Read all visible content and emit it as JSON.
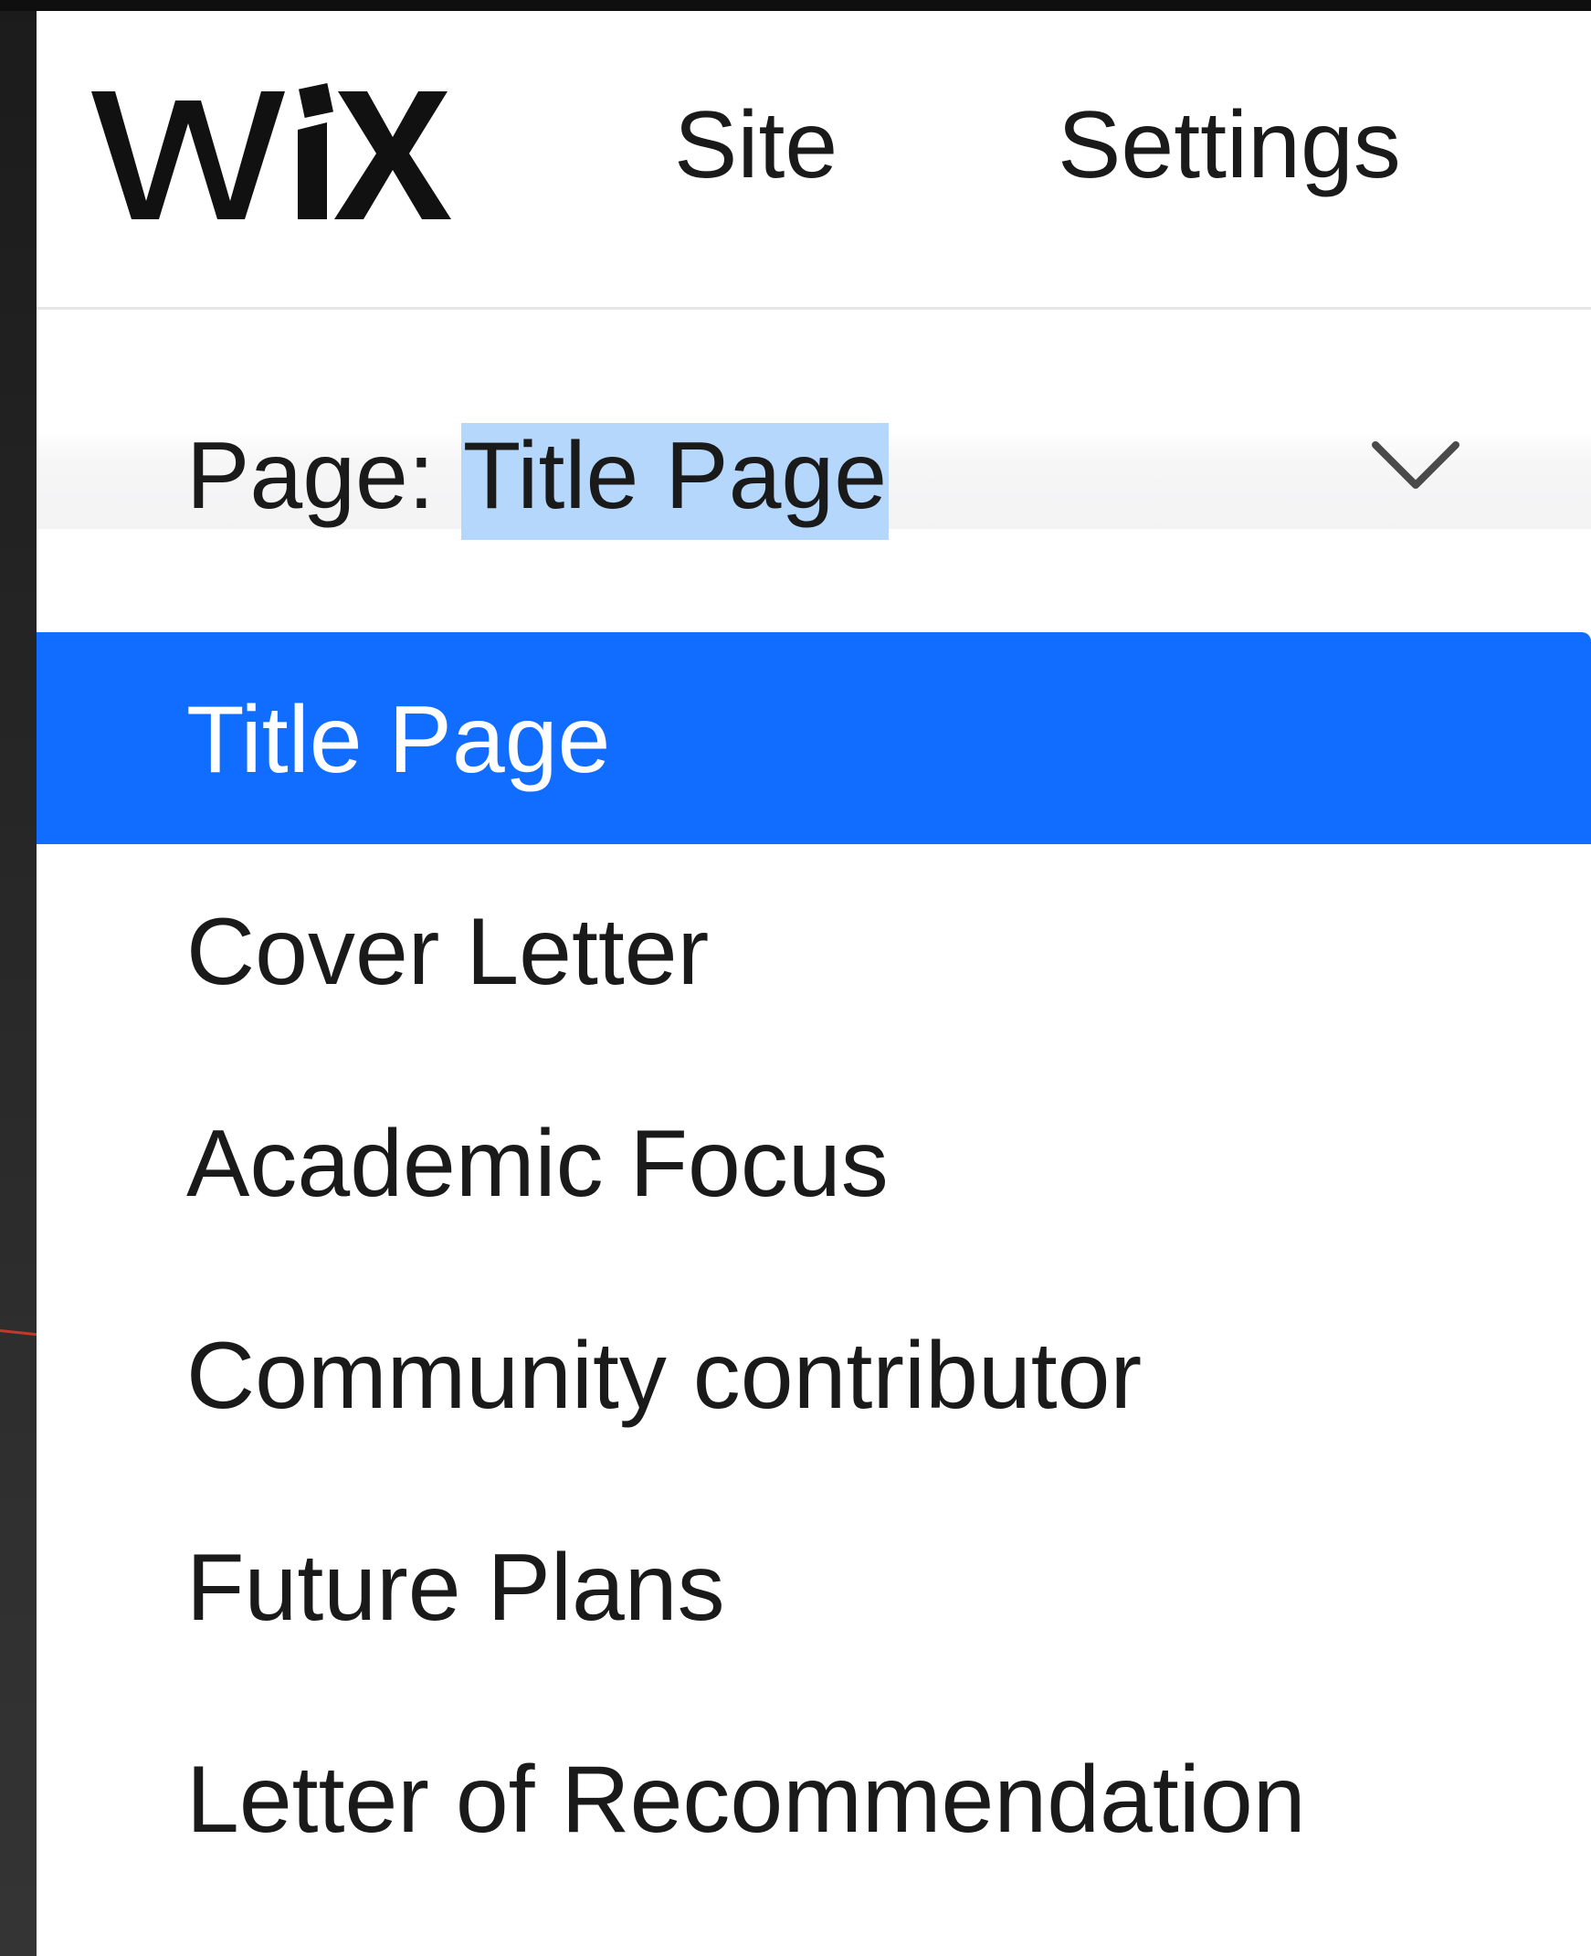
{
  "header": {
    "logo_text": "WiX",
    "nav": [
      {
        "label": "Site"
      },
      {
        "label": "Settings"
      }
    ]
  },
  "page_select": {
    "prefix": "Page:",
    "value": "Title Page",
    "icon": "chevron-down-icon"
  },
  "dropdown": {
    "selected_index": 0,
    "items": [
      {
        "label": "Title Page"
      },
      {
        "label": "Cover Letter"
      },
      {
        "label": "Academic Focus"
      },
      {
        "label": "Community contributor"
      },
      {
        "label": "Future Plans"
      },
      {
        "label": "Letter of Recommendation"
      }
    ]
  },
  "colors": {
    "accent": "#116dff",
    "selection_highlight": "#b4d7fb",
    "text": "#1a1a1a"
  }
}
